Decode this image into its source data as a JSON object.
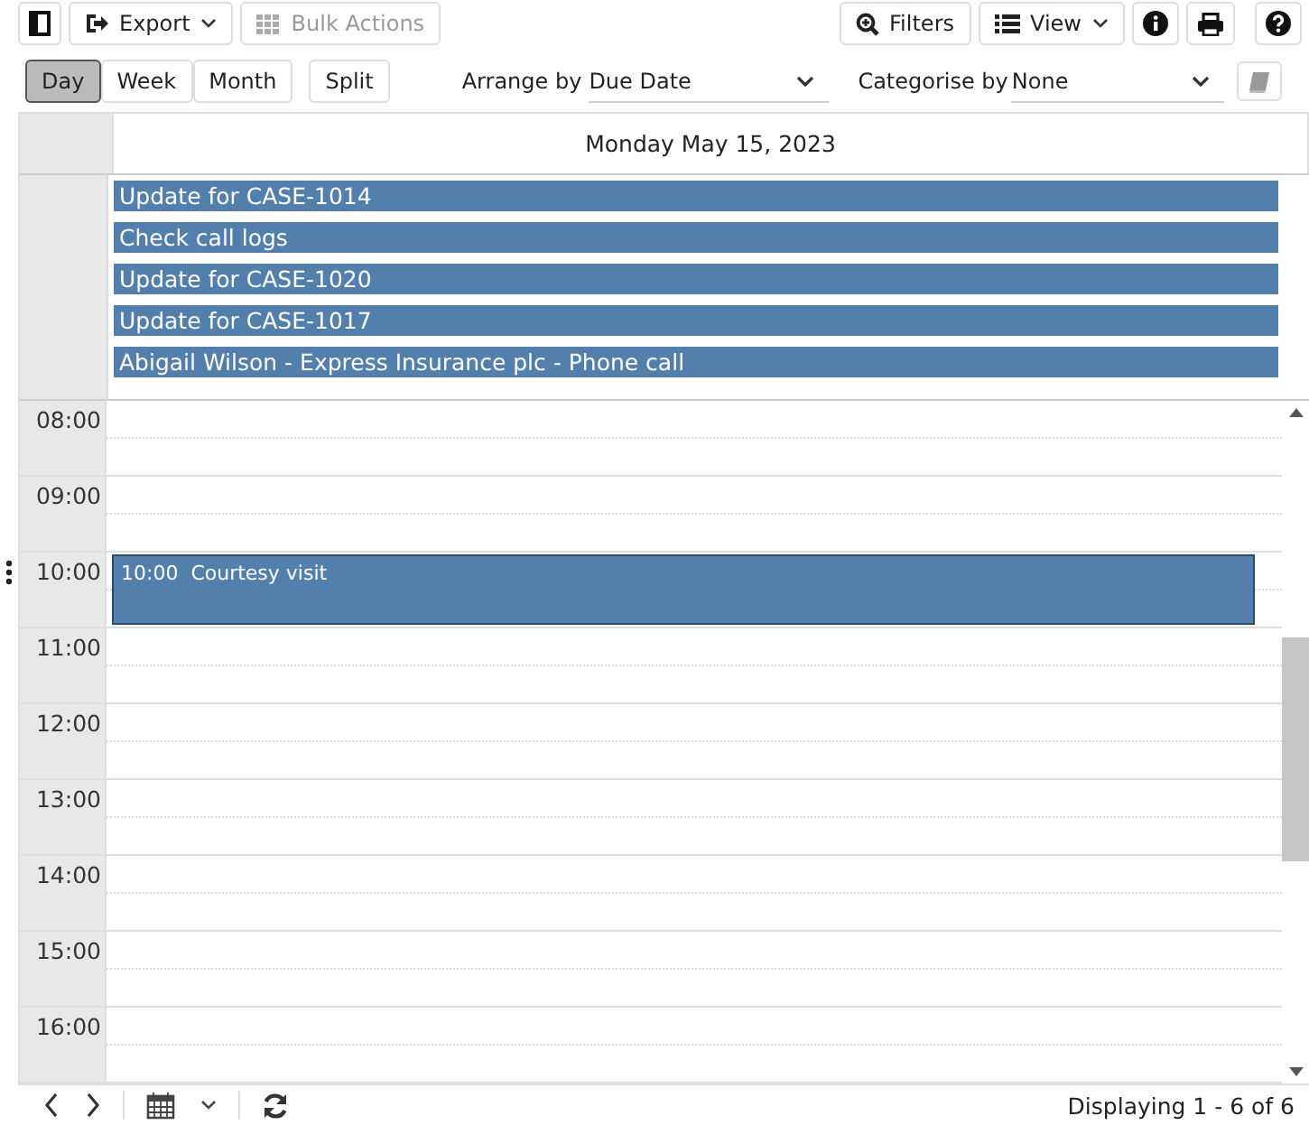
{
  "toolbar": {
    "export": "Export",
    "bulk_actions": {
      "label": "Bulk Actions",
      "disabled": true
    },
    "filters": "Filters",
    "view": "View"
  },
  "views": [
    {
      "label": "Day",
      "selected": true
    },
    {
      "label": "Week",
      "selected": false
    },
    {
      "label": "Month",
      "selected": false
    },
    {
      "label": "Split",
      "selected": false
    }
  ],
  "arrange": {
    "label": "Arrange by",
    "value": "Due Date"
  },
  "categorise": {
    "label": "Categorise by",
    "value": "None"
  },
  "calendar": {
    "date_header": "Monday May 15, 2023",
    "all_day_events": [
      "Update for CASE-1014",
      "Check call logs",
      "Update for CASE-1020",
      "Update for CASE-1017",
      "Abigail Wilson - Express Insurance plc - Phone call"
    ],
    "hours": [
      {
        "time": "08:00"
      },
      {
        "time": "09:00"
      },
      {
        "time": "10:00",
        "events": [
          {
            "time": "10:00",
            "title": "Courtesy visit"
          }
        ]
      },
      {
        "time": "11:00"
      },
      {
        "time": "12:00"
      },
      {
        "time": "13:00"
      },
      {
        "time": "14:00"
      },
      {
        "time": "15:00"
      },
      {
        "time": "16:00"
      }
    ]
  },
  "status": "Displaying 1 - 6 of 6"
}
